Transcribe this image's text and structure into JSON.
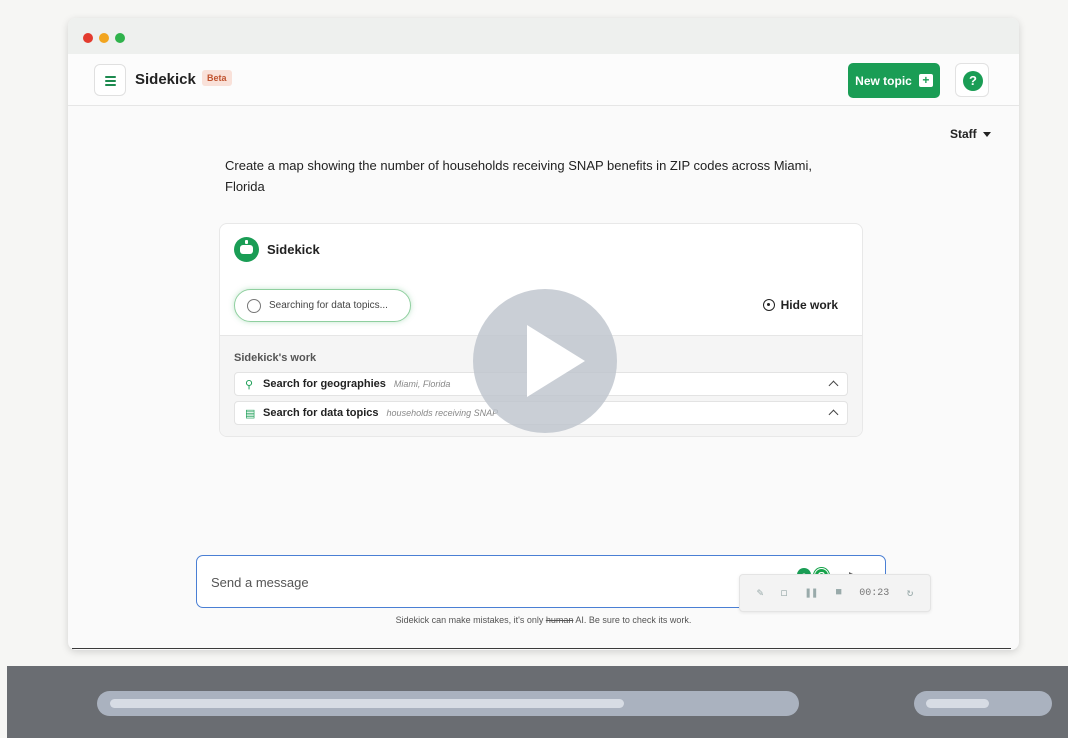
{
  "app": {
    "name": "Sidekick",
    "badge": "Beta",
    "new_topic_label": "New topic",
    "help_label": "?"
  },
  "user_menu": {
    "label": "Staff"
  },
  "prompt": {
    "text": "Create a map showing the number of households receiving SNAP benefits in ZIP codes across Miami, Florida"
  },
  "response_card": {
    "title": "Sidekick",
    "status": "Searching for data topics...",
    "hide_work_label": "Hide work",
    "work_label": "Sidekick's work",
    "steps": [
      {
        "icon": "map-pin-icon",
        "name": "Search for geographies",
        "detail": "Miami, Florida"
      },
      {
        "icon": "book-icon",
        "name": "Search for data topics",
        "detail": "households receiving SNAP"
      }
    ]
  },
  "composer": {
    "placeholder": "Send a message",
    "disclaimer_before": "Sidekick can make mistakes, it's only ",
    "disclaimer_strike": "human",
    "disclaimer_after": " AI. Be sure to check its work."
  },
  "recorder": {
    "time": "00:23"
  },
  "video_controls": {
    "progress_fraction": 0.76,
    "volume_fraction": 0.55
  },
  "colors": {
    "brand_green": "#1a9d55",
    "focus_blue": "#4a7fd4",
    "beta_bg": "#f9e1d9"
  }
}
